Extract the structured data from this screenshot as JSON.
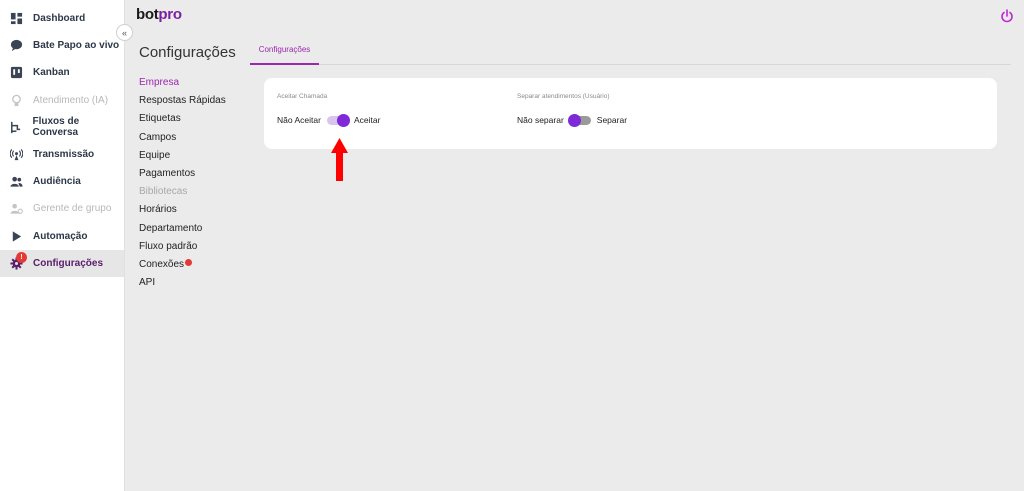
{
  "sidebar": {
    "collapse_glyph": "«",
    "items": [
      {
        "label": "Dashboard",
        "icon": "dashboard-icon",
        "state": "normal"
      },
      {
        "label": "Bate Papo ao vivo",
        "icon": "chat-bubble-icon",
        "state": "normal"
      },
      {
        "label": "Kanban",
        "icon": "kanban-icon",
        "state": "normal"
      },
      {
        "label": "Atendimento (IA)",
        "icon": "lightbulb-icon",
        "state": "disabled"
      },
      {
        "label": "Fluxos de Conversa",
        "icon": "flow-icon",
        "state": "normal"
      },
      {
        "label": "Transmissão",
        "icon": "broadcast-icon",
        "state": "normal"
      },
      {
        "label": "Audiência",
        "icon": "people-icon",
        "state": "normal"
      },
      {
        "label": "Gerente de grupo",
        "icon": "group-manager-icon",
        "state": "disabled"
      },
      {
        "label": "Automação",
        "icon": "play-icon",
        "state": "normal"
      },
      {
        "label": "Configurações",
        "icon": "gear-icon",
        "state": "active",
        "badge": "!"
      }
    ]
  },
  "header": {
    "logo_main": "bot",
    "logo_accent": "pro",
    "power_icon": "power-icon"
  },
  "page": {
    "title": "Configurações"
  },
  "settings_nav": {
    "items": [
      {
        "label": "Empresa",
        "state": "active"
      },
      {
        "label": "Respostas Rápidas",
        "state": "normal"
      },
      {
        "label": "Etiquetas",
        "state": "normal"
      },
      {
        "label": "Campos",
        "state": "normal"
      },
      {
        "label": "Equipe",
        "state": "normal"
      },
      {
        "label": "Pagamentos",
        "state": "normal"
      },
      {
        "label": "Bibliotecas",
        "state": "disabled"
      },
      {
        "label": "Horários",
        "state": "normal"
      },
      {
        "label": "Departamento",
        "state": "normal"
      },
      {
        "label": "Fluxo padrão",
        "state": "normal"
      },
      {
        "label": "Conexões",
        "state": "normal",
        "dot": true
      },
      {
        "label": "API",
        "state": "normal"
      }
    ]
  },
  "tabs": [
    {
      "label": "Configurações",
      "active": true
    }
  ],
  "options": {
    "accept_call": {
      "label": "Aceitar Chamada",
      "off_label": "Não Aceitar",
      "on_label": "Aceitar",
      "enabled": true
    },
    "separate": {
      "label": "Separar atendimentos (Usuário)",
      "off_label": "Não separar",
      "on_label": "Separar",
      "enabled": false
    }
  },
  "colors": {
    "accent": "#9c27b0",
    "toggle_knob": "#7e2ad8",
    "badge_red": "#e53935",
    "annotation_arrow": "#ff0000"
  }
}
